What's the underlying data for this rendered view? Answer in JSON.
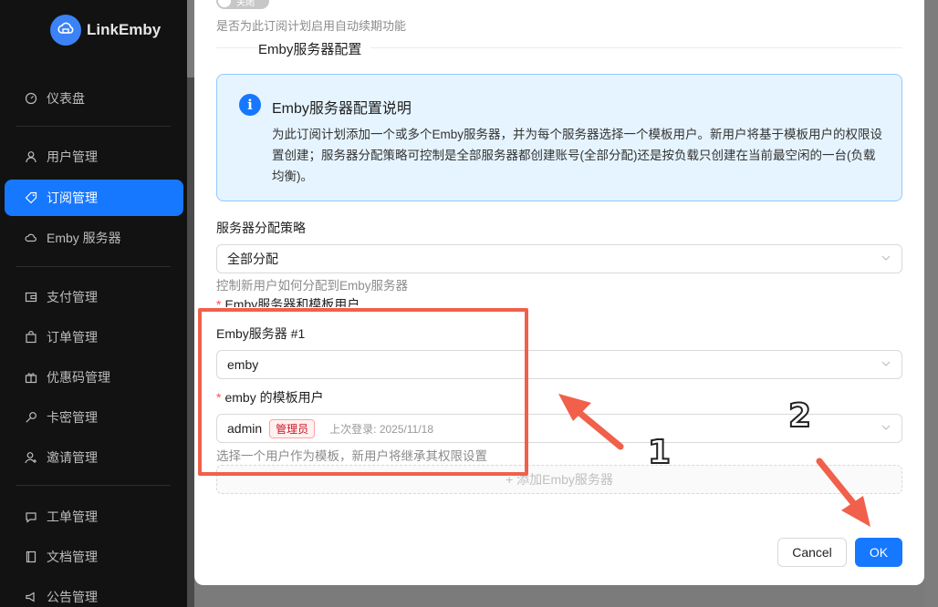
{
  "app": {
    "name": "LinkEmby"
  },
  "sidebar": {
    "items": [
      {
        "label": "仪表盘",
        "icon": "dashboard-icon"
      },
      {
        "label": "用户管理",
        "icon": "user-icon"
      },
      {
        "label": "订阅管理",
        "icon": "tag-icon",
        "active": true
      },
      {
        "label": "Emby 服务器",
        "icon": "cloud-icon"
      },
      {
        "label": "支付管理",
        "icon": "wallet-icon"
      },
      {
        "label": "订单管理",
        "icon": "bag-icon"
      },
      {
        "label": "优惠码管理",
        "icon": "gift-icon"
      },
      {
        "label": "卡密管理",
        "icon": "key-icon"
      },
      {
        "label": "邀请管理",
        "icon": "user-add-icon"
      },
      {
        "label": "工单管理",
        "icon": "chat-icon"
      },
      {
        "label": "文档管理",
        "icon": "book-icon"
      },
      {
        "label": "公告管理",
        "icon": "notification-icon"
      }
    ]
  },
  "modal": {
    "toggle_label": "关闭",
    "auto_renew_help": "是否为此订阅计划启用自动续期功能",
    "section_title": "Emby服务器配置",
    "alert": {
      "title": "Emby服务器配置说明",
      "body": "为此订阅计划添加一个或多个Emby服务器，并为每个服务器选择一个模板用户。新用户将基于模板用户的权限设置创建；服务器分配策略可控制是全部服务器都创建账号(全部分配)还是按负载只创建在当前最空闲的一台(负载均衡)。"
    },
    "strategy": {
      "label": "服务器分配策略",
      "value": "全部分配",
      "help": "控制新用户如何分配到Emby服务器"
    },
    "servers_label": "Emby服务器和模板用户",
    "server_1": {
      "label": "Emby服务器 #1",
      "value": "emby",
      "template_label": "emby 的模板用户",
      "template_user": "admin",
      "template_role": "管理员",
      "template_last_login": "上次登录: 2025/11/18",
      "template_help": "选择一个用户作为模板，新用户将继承其权限设置"
    },
    "add_server_label": "+ 添加Emby服务器",
    "cancel_label": "Cancel",
    "ok_label": "OK"
  },
  "annotations": {
    "marker_1": "1",
    "marker_2": "2",
    "color": "#f0604a"
  },
  "colors": {
    "primary": "#1677ff",
    "sidebar_bg": "#121212",
    "alert_bg": "#e6f4ff"
  }
}
